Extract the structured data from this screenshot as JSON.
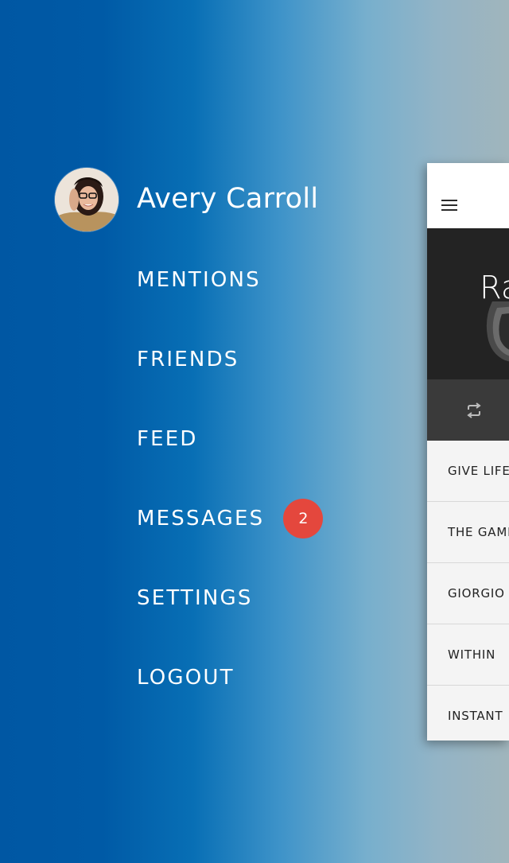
{
  "user": {
    "name": "Avery Carroll"
  },
  "menu": {
    "items": [
      {
        "label": "MENTIONS"
      },
      {
        "label": "FRIENDS"
      },
      {
        "label": "FEED"
      },
      {
        "label": "MESSAGES",
        "badge": "2"
      },
      {
        "label": "SETTINGS"
      },
      {
        "label": "LOGOUT"
      }
    ]
  },
  "preview": {
    "header_icon": "hamburger-menu-icon",
    "hero_title": "Ra",
    "control_icon": "repeat-icon",
    "tracks": [
      {
        "label": "GIVE LIFE"
      },
      {
        "label": "THE GAME"
      },
      {
        "label": "GIORGIO"
      },
      {
        "label": "WITHIN"
      },
      {
        "label": "INSTANT"
      }
    ]
  },
  "colors": {
    "badge": "#e4473d",
    "gradient_start": "#0057a3",
    "gradient_end": "#a0b5bc",
    "hero_bg": "#232323",
    "controls_bg": "#3a3a3a",
    "list_bg": "#f4f4f4"
  }
}
